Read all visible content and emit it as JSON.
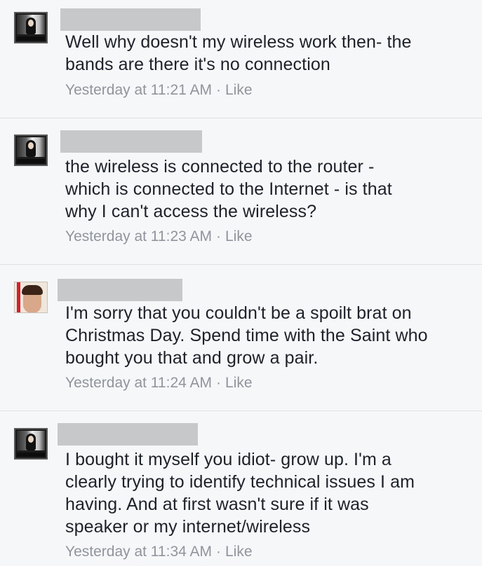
{
  "comments": [
    {
      "lines": [
        "Well why doesn't my wireless work then- the",
        "bands are there it's no connection"
      ],
      "time": "Yesterday at 11:21 AM",
      "separator": "·",
      "like": "Like"
    },
    {
      "lines": [
        "the wireless is connected to the router -",
        "which is connected to the Internet - is that",
        "why I can't access the wireless?"
      ],
      "time": "Yesterday at 11:23 AM",
      "separator": "·",
      "like": "Like"
    },
    {
      "lines": [
        "I'm sorry that you couldn't be a spoilt brat on",
        "Christmas Day. Spend time with the Saint who",
        "bought you that and grow a pair."
      ],
      "time": "Yesterday at 11:24 AM",
      "separator": "·",
      "like": "Like"
    },
    {
      "lines": [
        "I bought it myself you idiot- grow up. I'm a",
        "clearly trying to identify technical issues I am",
        "having. And at first wasn't sure if it was",
        "speaker or my internet/wireless"
      ],
      "time": "Yesterday at 11:34 AM",
      "separator": "·",
      "like": "Like"
    }
  ]
}
